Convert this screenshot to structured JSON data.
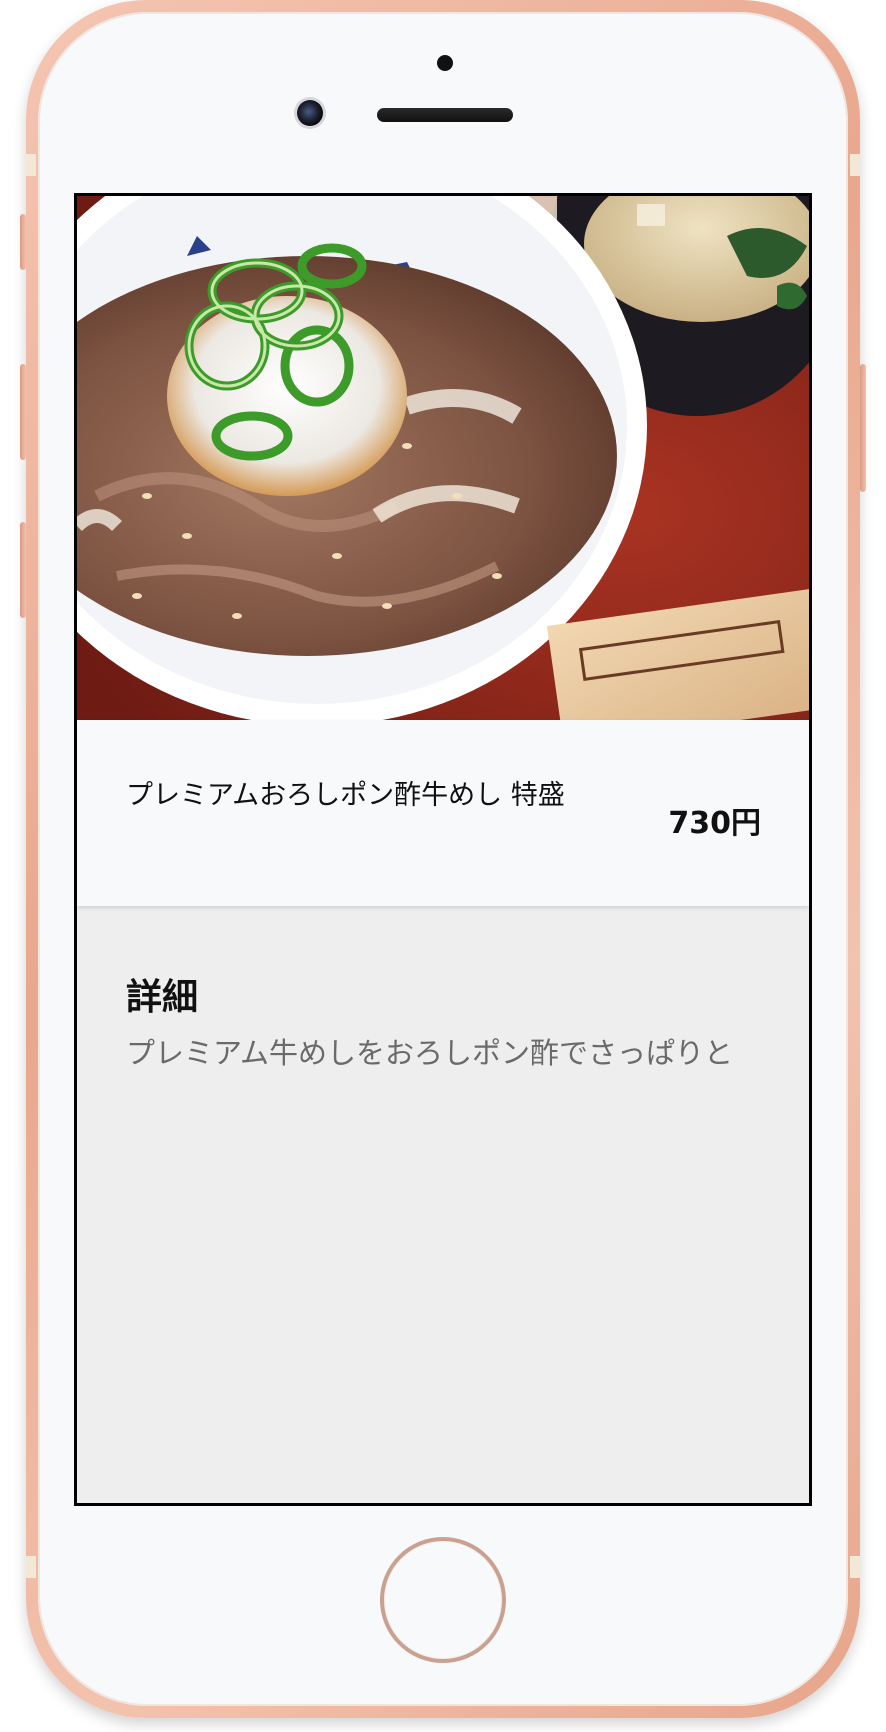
{
  "device": {
    "frame_color": "#eab09a",
    "screen_border_color": "#000000"
  },
  "menu_item": {
    "image_alt": "プレミアムおろしポン酢牛めし 特盛",
    "name": "プレミアムおろしポン酢牛めし 特盛",
    "price": "730円"
  },
  "details": {
    "heading": "詳細",
    "description": "プレミアム牛めしをおろしポン酢でさっぱりと"
  },
  "colors": {
    "card_background": "#f8f9fb",
    "detail_background": "#eeeeee",
    "description_text": "#6a6a6a"
  },
  "icons": {
    "home": "home-button-icon",
    "camera": "front-camera-icon",
    "speaker": "earpiece-speaker-icon",
    "sensor": "proximity-sensor-icon"
  }
}
